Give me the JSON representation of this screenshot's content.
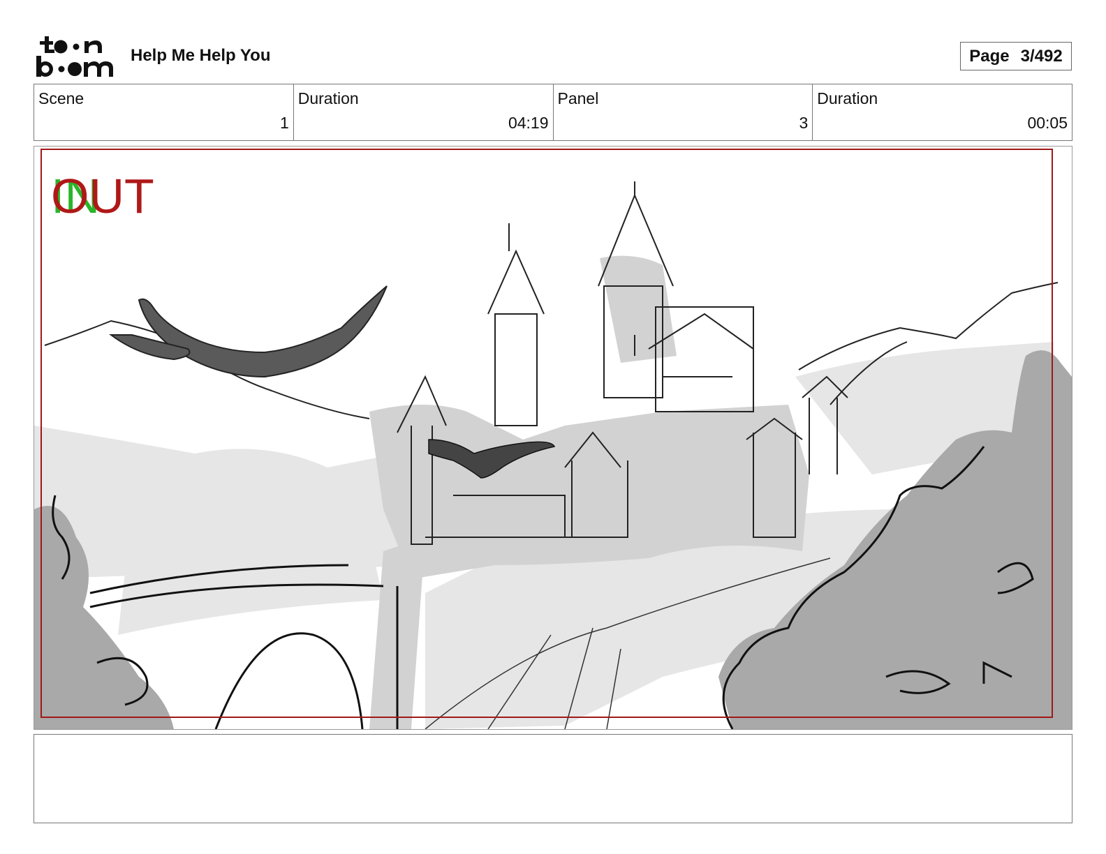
{
  "header": {
    "logo": {
      "line1": "toon",
      "line2": "boom",
      "icon": "toon-boom-logo"
    },
    "project_title": "Help Me Help You",
    "page_label": "Page",
    "page_value": "3/492"
  },
  "info": {
    "scene_label": "Scene",
    "scene_value": "1",
    "scene_duration_label": "Duration",
    "scene_duration_value": "04:19",
    "panel_label": "Panel",
    "panel_value": "3",
    "panel_duration_label": "Duration",
    "panel_duration_value": "00:05"
  },
  "panel": {
    "marker_in": "IN",
    "marker_out": "OUT",
    "marker_in_color": "#2ab52a",
    "marker_out_color": "#b01818",
    "safe_frame_color": "#a01818"
  },
  "notes": {
    "text": ""
  }
}
